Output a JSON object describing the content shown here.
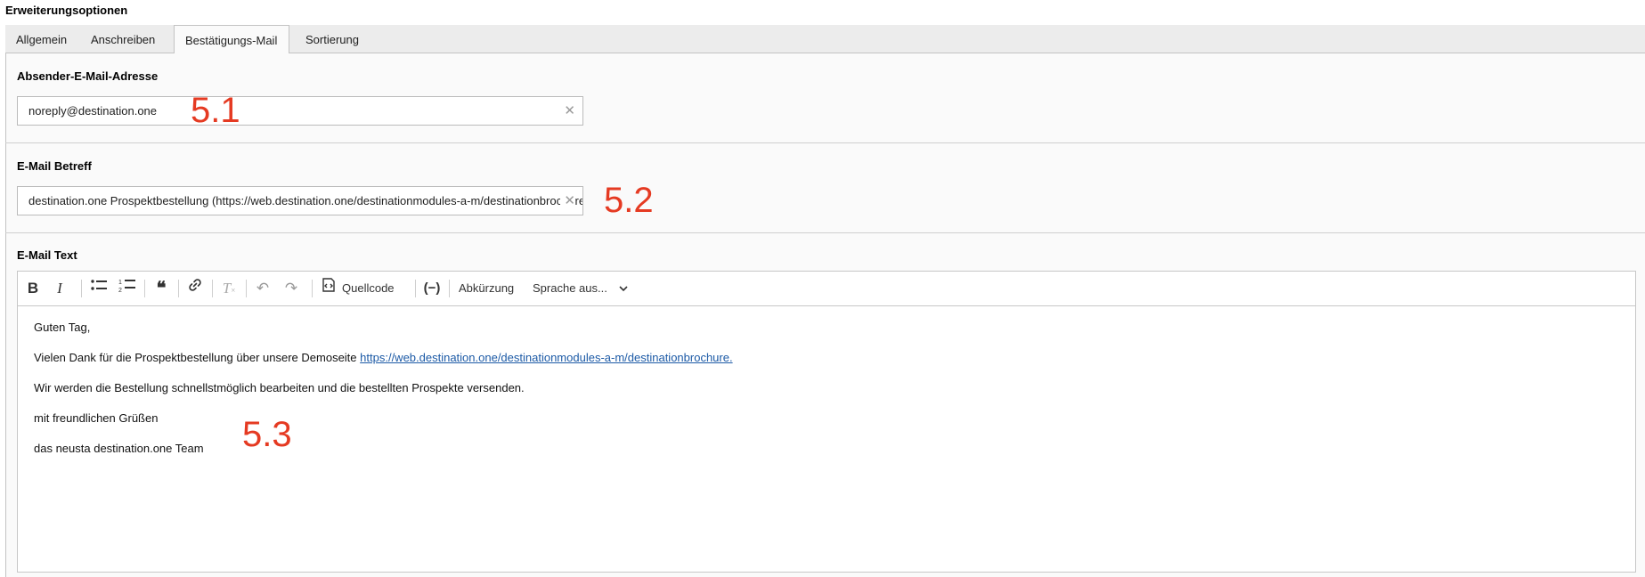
{
  "section_title": "Erweiterungsoptionen",
  "tabs": [
    {
      "label": "Allgemein",
      "active": false
    },
    {
      "label": "Anschreiben",
      "active": false
    },
    {
      "label": "Bestätigungs-Mail",
      "active": true
    },
    {
      "label": "Sortierung",
      "active": false
    }
  ],
  "sender": {
    "label": "Absender-E-Mail-Adresse",
    "value": "noreply@destination.one",
    "annotation": "5.1"
  },
  "subject": {
    "label": "E-Mail Betreff",
    "value": "destination.one Prospektbestellung (https://web.destination.one/destinationmodules-a-m/destinationbrochure)",
    "annotation": "5.2"
  },
  "body": {
    "label": "E-Mail Text",
    "annotation": "5.3",
    "toolbar": {
      "source_label": "Quellcode",
      "abbr_label": "Abkürzung",
      "language_label": "Sprache aus..."
    },
    "lines": {
      "greeting": "Guten Tag,",
      "thanks_prefix": "Vielen Dank für die Prospektbestellung über unsere Demoseite",
      "thanks_link": "https://web.destination.one/destinationmodules-a-m/destinationbrochure.",
      "processing": "Wir werden die Bestellung schnellstmöglich bearbeiten und die bestellten Prospekte versenden.",
      "closing": "mit freundlichen Grüßen",
      "signature": "das neusta destination.one Team"
    }
  },
  "colors": {
    "annotation": "#e53a22",
    "link": "#1c5aa6",
    "tabbar_bg": "#ececec",
    "panel_bg": "#fafafa"
  }
}
